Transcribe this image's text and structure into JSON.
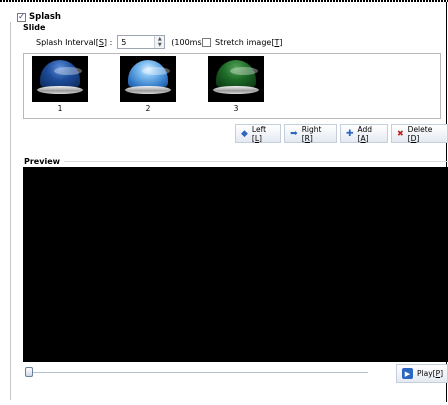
{
  "splash": {
    "label": "Splash",
    "checked": true,
    "check_glyph": "✓"
  },
  "slide": {
    "group_label": "Slide",
    "interval_label_pre": "Splash Interval[",
    "interval_label_key": "S",
    "interval_label_post": "] :",
    "interval_value": "5",
    "interval_unit": "(100ms)",
    "stretch_label_pre": "Stretch image[",
    "stretch_label_key": "T",
    "stretch_label_post": "]",
    "stretch_checked": false,
    "thumbnails": [
      {
        "label": "1",
        "color": "#1d4c9a"
      },
      {
        "label": "2",
        "color": "#7fbdf0"
      },
      {
        "label": "3",
        "color": "#1d6a27"
      }
    ]
  },
  "toolbar": {
    "left": {
      "label_pre": "Left [",
      "key": "L",
      "label_post": "]",
      "icon": "arrow-left-icon"
    },
    "right": {
      "label_pre": "Right [",
      "key": "R",
      "label_post": "]",
      "icon": "arrow-right-icon"
    },
    "add": {
      "label_pre": "Add [",
      "key": "A",
      "label_post": "]",
      "icon": "add-icon"
    },
    "delete": {
      "label_pre": "Delete [",
      "key": "D",
      "label_post": "]",
      "icon": "delete-icon"
    }
  },
  "preview": {
    "label": "Preview",
    "slider_position": 0,
    "play": {
      "label_pre": "Play[",
      "key": "P",
      "label_post": "]",
      "icon": "play-icon"
    }
  }
}
